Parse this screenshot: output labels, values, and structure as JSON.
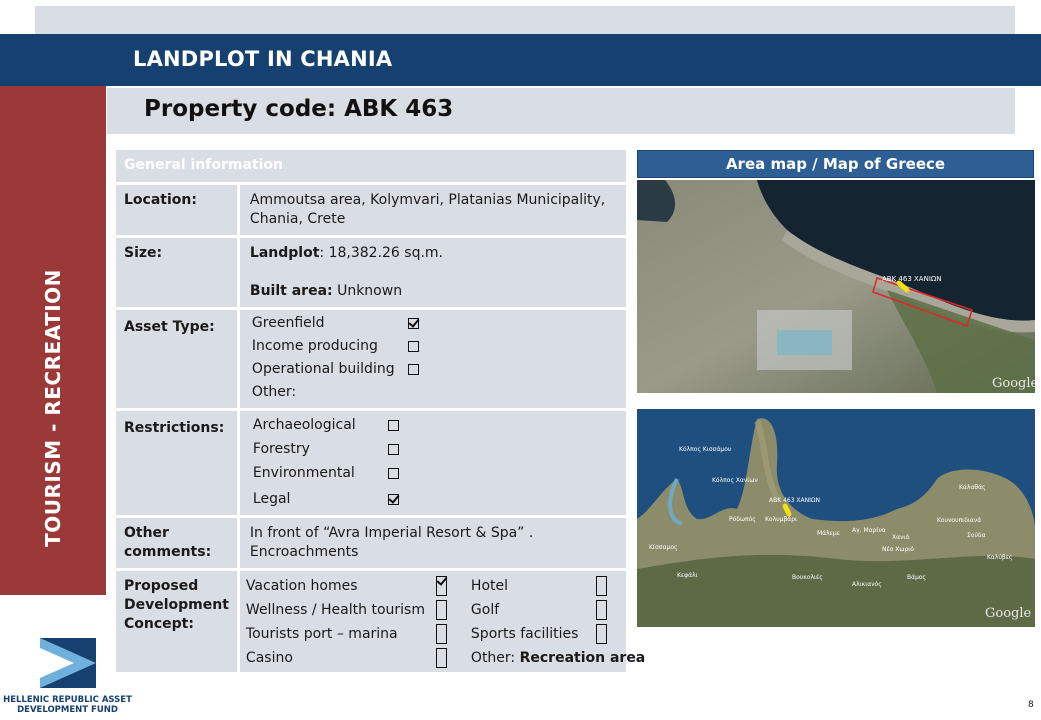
{
  "header": {
    "title": "LANDPLOT IN CHANIA",
    "property_code": "Property code: ABK 463"
  },
  "sidebar": {
    "label": "TOURISM - RECREATION"
  },
  "general_info": {
    "heading": "General information",
    "location": {
      "label": "Location:",
      "value": "Ammoutsa area, Kolymvari, Platanias Municipality, Chania, Crete"
    },
    "size": {
      "label": "Size:",
      "landplot_label": "Landplot",
      "landplot_value": ": 18,382.26 sq.m.",
      "built_label": "Built area:",
      "built_value": " Unknown"
    },
    "asset_type": {
      "label": "Asset Type:",
      "options": [
        {
          "name": "Greenfield",
          "checked": true
        },
        {
          "name": "Income producing",
          "checked": false
        },
        {
          "name": "Operational building",
          "checked": false
        }
      ],
      "other": "Other:"
    },
    "restrictions": {
      "label": "Restrictions:",
      "options": [
        {
          "name": "Archaeological",
          "checked": false
        },
        {
          "name": "Forestry",
          "checked": false
        },
        {
          "name": "Environmental",
          "checked": false
        },
        {
          "name": "Legal",
          "checked": true
        }
      ]
    },
    "other_comments": {
      "label": "Other comments:",
      "value": "In front of “Avra Imperial Resort & Spa” . Encroachments"
    },
    "development": {
      "label": "Proposed Development Concept:",
      "left": [
        {
          "name": "Vacation homes",
          "checked": true
        },
        {
          "name": "Wellness  / Health tourism",
          "checked": false
        },
        {
          "name": "Tourists port – marina",
          "checked": false
        },
        {
          "name": "Casino",
          "checked": false
        }
      ],
      "right": [
        {
          "name": "Hotel",
          "checked": false
        },
        {
          "name": "Golf",
          "checked": false
        },
        {
          "name": "Sports facilities",
          "checked": false
        }
      ],
      "other_label": "Other: ",
      "other_value": "Recreation area"
    }
  },
  "maps": {
    "heading": "Area map / Map of Greece",
    "area_marker_label": "ΑΒΚ 463 ΧΑΝΙΩΝ",
    "watermark": "Google",
    "regional_labels": [
      "Κόλπος Κισσάμου",
      "Κόλπος Χανίων",
      "Ρόδωπός",
      "Κολυμβάρι",
      "Κίσσαμος",
      "Μάλεμε",
      "Αγ. Μαρίνα",
      "Χανιά",
      "Κουνουπιδιανά",
      "Σούδα",
      "Καλύβες",
      "Καλαθάς",
      "Νέο Χωριό",
      "Βουκολιές",
      "Αλικιανός",
      "Βάμος",
      "Κεφάλι"
    ],
    "regional_marker_label": "ΑΒΚ 463 ΧΑΝΙΩΝ"
  },
  "footer": {
    "org_line1": "HELLENIC REPUBLIC ASSET",
    "org_line2": "DEVELOPMENT FUND",
    "page": "8"
  }
}
